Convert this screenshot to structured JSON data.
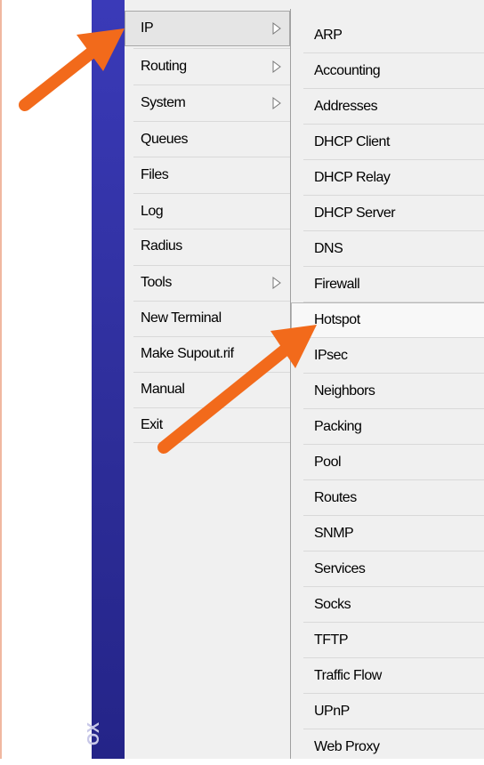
{
  "sidebar": {
    "brand_text": "OX",
    "color": "#3a3ab8"
  },
  "main_menu": {
    "items": [
      {
        "label": "IP",
        "has_submenu": true,
        "selected": true
      },
      {
        "label": "Routing",
        "has_submenu": true
      },
      {
        "label": "System",
        "has_submenu": true
      },
      {
        "label": "Queues",
        "has_submenu": false
      },
      {
        "label": "Files",
        "has_submenu": false
      },
      {
        "label": "Log",
        "has_submenu": false
      },
      {
        "label": "Radius",
        "has_submenu": false
      },
      {
        "label": "Tools",
        "has_submenu": true
      },
      {
        "label": "New Terminal",
        "has_submenu": false
      },
      {
        "label": "Make Supout.rif",
        "has_submenu": false
      },
      {
        "label": "Manual",
        "has_submenu": false
      },
      {
        "label": "Exit",
        "has_submenu": false
      }
    ]
  },
  "submenu": {
    "items": [
      {
        "label": "ARP"
      },
      {
        "label": "Accounting"
      },
      {
        "label": "Addresses"
      },
      {
        "label": "DHCP Client"
      },
      {
        "label": "DHCP Relay"
      },
      {
        "label": "DHCP Server"
      },
      {
        "label": "DNS"
      },
      {
        "label": "Firewall"
      },
      {
        "label": "Hotspot",
        "hovered": true
      },
      {
        "label": "IPsec"
      },
      {
        "label": "Neighbors"
      },
      {
        "label": "Packing"
      },
      {
        "label": "Pool"
      },
      {
        "label": "Routes"
      },
      {
        "label": "SNMP"
      },
      {
        "label": "Services"
      },
      {
        "label": "Socks"
      },
      {
        "label": "TFTP"
      },
      {
        "label": "Traffic Flow"
      },
      {
        "label": "UPnP"
      },
      {
        "label": "Web Proxy"
      }
    ]
  },
  "annotations": {
    "arrow_color": "#f26a1b"
  }
}
